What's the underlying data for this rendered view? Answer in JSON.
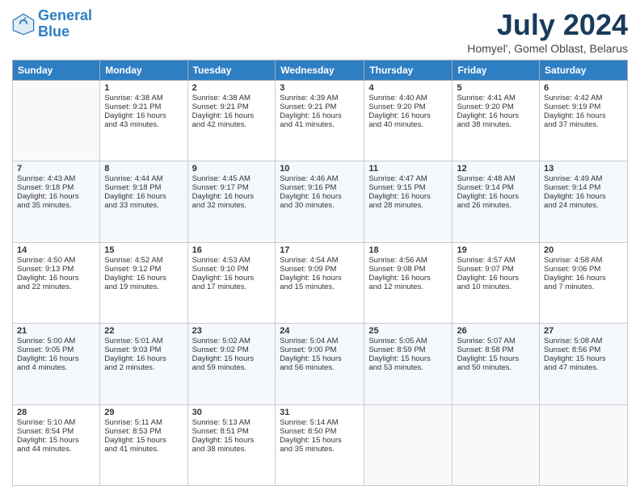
{
  "header": {
    "logo_line1": "General",
    "logo_line2": "Blue",
    "month": "July 2024",
    "location": "Homyel', Gomel Oblast, Belarus"
  },
  "columns": [
    "Sunday",
    "Monday",
    "Tuesday",
    "Wednesday",
    "Thursday",
    "Friday",
    "Saturday"
  ],
  "weeks": [
    [
      {
        "day": "",
        "info": ""
      },
      {
        "day": "1",
        "info": "Sunrise: 4:38 AM\nSunset: 9:21 PM\nDaylight: 16 hours\nand 43 minutes."
      },
      {
        "day": "2",
        "info": "Sunrise: 4:38 AM\nSunset: 9:21 PM\nDaylight: 16 hours\nand 42 minutes."
      },
      {
        "day": "3",
        "info": "Sunrise: 4:39 AM\nSunset: 9:21 PM\nDaylight: 16 hours\nand 41 minutes."
      },
      {
        "day": "4",
        "info": "Sunrise: 4:40 AM\nSunset: 9:20 PM\nDaylight: 16 hours\nand 40 minutes."
      },
      {
        "day": "5",
        "info": "Sunrise: 4:41 AM\nSunset: 9:20 PM\nDaylight: 16 hours\nand 38 minutes."
      },
      {
        "day": "6",
        "info": "Sunrise: 4:42 AM\nSunset: 9:19 PM\nDaylight: 16 hours\nand 37 minutes."
      }
    ],
    [
      {
        "day": "7",
        "info": "Sunrise: 4:43 AM\nSunset: 9:18 PM\nDaylight: 16 hours\nand 35 minutes."
      },
      {
        "day": "8",
        "info": "Sunrise: 4:44 AM\nSunset: 9:18 PM\nDaylight: 16 hours\nand 33 minutes."
      },
      {
        "day": "9",
        "info": "Sunrise: 4:45 AM\nSunset: 9:17 PM\nDaylight: 16 hours\nand 32 minutes."
      },
      {
        "day": "10",
        "info": "Sunrise: 4:46 AM\nSunset: 9:16 PM\nDaylight: 16 hours\nand 30 minutes."
      },
      {
        "day": "11",
        "info": "Sunrise: 4:47 AM\nSunset: 9:15 PM\nDaylight: 16 hours\nand 28 minutes."
      },
      {
        "day": "12",
        "info": "Sunrise: 4:48 AM\nSunset: 9:14 PM\nDaylight: 16 hours\nand 26 minutes."
      },
      {
        "day": "13",
        "info": "Sunrise: 4:49 AM\nSunset: 9:14 PM\nDaylight: 16 hours\nand 24 minutes."
      }
    ],
    [
      {
        "day": "14",
        "info": "Sunrise: 4:50 AM\nSunset: 9:13 PM\nDaylight: 16 hours\nand 22 minutes."
      },
      {
        "day": "15",
        "info": "Sunrise: 4:52 AM\nSunset: 9:12 PM\nDaylight: 16 hours\nand 19 minutes."
      },
      {
        "day": "16",
        "info": "Sunrise: 4:53 AM\nSunset: 9:10 PM\nDaylight: 16 hours\nand 17 minutes."
      },
      {
        "day": "17",
        "info": "Sunrise: 4:54 AM\nSunset: 9:09 PM\nDaylight: 16 hours\nand 15 minutes."
      },
      {
        "day": "18",
        "info": "Sunrise: 4:56 AM\nSunset: 9:08 PM\nDaylight: 16 hours\nand 12 minutes."
      },
      {
        "day": "19",
        "info": "Sunrise: 4:57 AM\nSunset: 9:07 PM\nDaylight: 16 hours\nand 10 minutes."
      },
      {
        "day": "20",
        "info": "Sunrise: 4:58 AM\nSunset: 9:06 PM\nDaylight: 16 hours\nand 7 minutes."
      }
    ],
    [
      {
        "day": "21",
        "info": "Sunrise: 5:00 AM\nSunset: 9:05 PM\nDaylight: 16 hours\nand 4 minutes."
      },
      {
        "day": "22",
        "info": "Sunrise: 5:01 AM\nSunset: 9:03 PM\nDaylight: 16 hours\nand 2 minutes."
      },
      {
        "day": "23",
        "info": "Sunrise: 5:02 AM\nSunset: 9:02 PM\nDaylight: 15 hours\nand 59 minutes."
      },
      {
        "day": "24",
        "info": "Sunrise: 5:04 AM\nSunset: 9:00 PM\nDaylight: 15 hours\nand 56 minutes."
      },
      {
        "day": "25",
        "info": "Sunrise: 5:05 AM\nSunset: 8:59 PM\nDaylight: 15 hours\nand 53 minutes."
      },
      {
        "day": "26",
        "info": "Sunrise: 5:07 AM\nSunset: 8:58 PM\nDaylight: 15 hours\nand 50 minutes."
      },
      {
        "day": "27",
        "info": "Sunrise: 5:08 AM\nSunset: 8:56 PM\nDaylight: 15 hours\nand 47 minutes."
      }
    ],
    [
      {
        "day": "28",
        "info": "Sunrise: 5:10 AM\nSunset: 8:54 PM\nDaylight: 15 hours\nand 44 minutes."
      },
      {
        "day": "29",
        "info": "Sunrise: 5:11 AM\nSunset: 8:53 PM\nDaylight: 15 hours\nand 41 minutes."
      },
      {
        "day": "30",
        "info": "Sunrise: 5:13 AM\nSunset: 8:51 PM\nDaylight: 15 hours\nand 38 minutes."
      },
      {
        "day": "31",
        "info": "Sunrise: 5:14 AM\nSunset: 8:50 PM\nDaylight: 15 hours\nand 35 minutes."
      },
      {
        "day": "",
        "info": ""
      },
      {
        "day": "",
        "info": ""
      },
      {
        "day": "",
        "info": ""
      }
    ]
  ]
}
